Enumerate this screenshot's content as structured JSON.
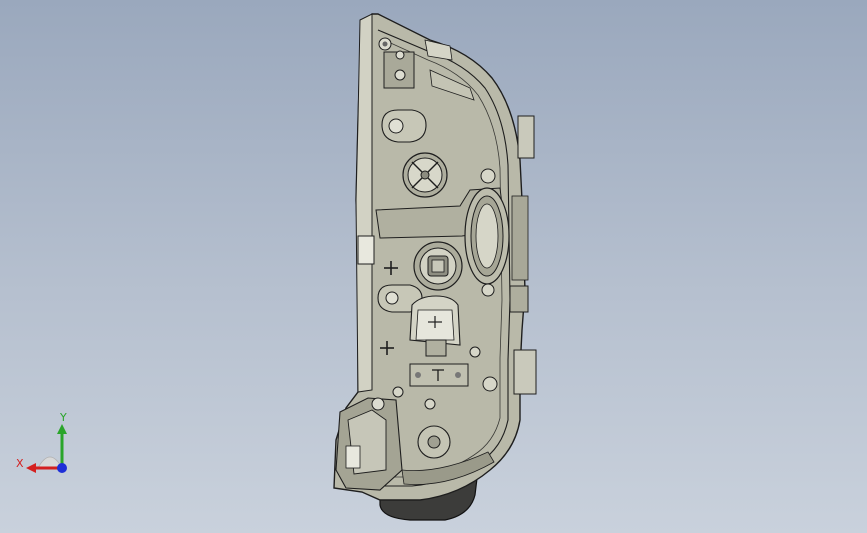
{
  "viewport": {
    "background_top": "#9aa8bd",
    "background_bottom": "#c9d1dc",
    "model_fill": "#b8b8a8",
    "model_edge": "#1e1e1e"
  },
  "triad": {
    "x_label": "X",
    "y_label": "Y",
    "x_color": "#d42020",
    "y_color": "#2aa52a",
    "z_color": "#1e2fd8"
  }
}
